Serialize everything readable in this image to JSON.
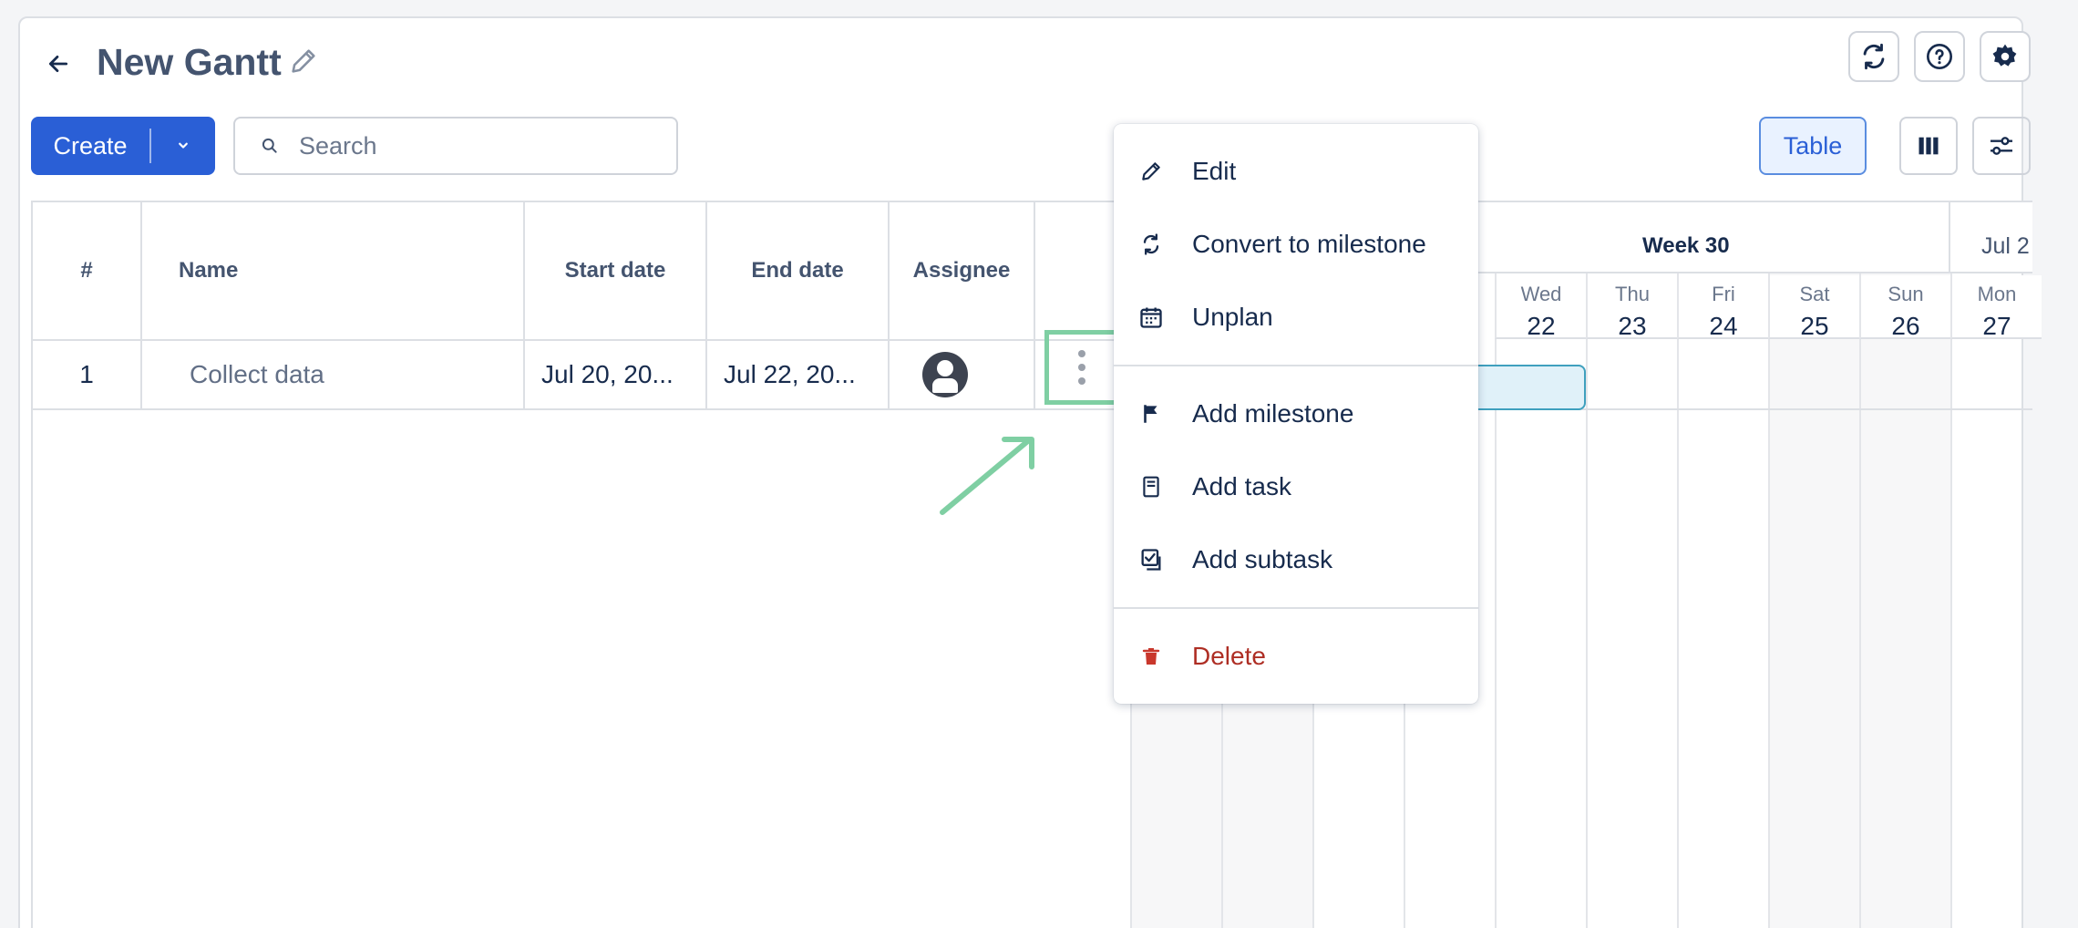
{
  "header": {
    "title": "New Gantt"
  },
  "toolbar": {
    "create_label": "Create",
    "search_placeholder": "Search",
    "view_table_label": "Table"
  },
  "table": {
    "columns": [
      "#",
      "Name",
      "Start date",
      "End date",
      "Assignee"
    ],
    "rows": [
      {
        "num": "1",
        "name": "Collect data",
        "start": "Jul 20, 20...",
        "end": "Jul 22, 20..."
      }
    ]
  },
  "timeline": {
    "week": "Week 30",
    "next_week_partial": "Jul 2",
    "days": [
      {
        "name": "Wed",
        "num": "22"
      },
      {
        "name": "Thu",
        "num": "23"
      },
      {
        "name": "Fri",
        "num": "24"
      },
      {
        "name": "Sat",
        "num": "25"
      },
      {
        "name": "Sun",
        "num": "26"
      },
      {
        "name": "Mon",
        "num": "27"
      }
    ]
  },
  "context_menu": {
    "items": [
      {
        "label": "Edit",
        "icon": "pencil-icon"
      },
      {
        "label": "Convert to milestone",
        "icon": "convert-icon"
      },
      {
        "label": "Unplan",
        "icon": "calendar-icon"
      },
      {
        "label": "Add milestone",
        "icon": "flag-icon"
      },
      {
        "label": "Add task",
        "icon": "task-icon"
      },
      {
        "label": "Add subtask",
        "icon": "subtask-icon"
      },
      {
        "label": "Delete",
        "icon": "trash-icon"
      }
    ]
  },
  "colors": {
    "primary": "#2a5fd6",
    "highlight": "#7fcfa3",
    "danger": "#ae2e24",
    "task_bar": "#e0f1f9"
  }
}
